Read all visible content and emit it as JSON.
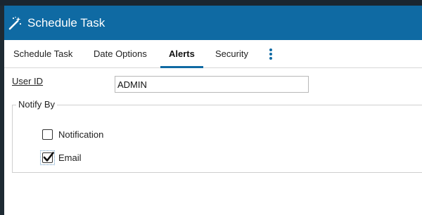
{
  "window": {
    "title": "Schedule Task",
    "icon": "magic-wand-icon"
  },
  "tabs": [
    {
      "label": "Schedule Task",
      "active": false
    },
    {
      "label": "Date Options",
      "active": false
    },
    {
      "label": "Alerts",
      "active": true
    },
    {
      "label": "Security",
      "active": false
    }
  ],
  "more_menu_icon": "kebab-menu-icon",
  "form": {
    "user_id_label": "User ID",
    "user_id_value": "ADMIN",
    "notify_by": {
      "legend": "Notify By",
      "options": [
        {
          "label": "Notification",
          "checked": false
        },
        {
          "label": "Email",
          "checked": true
        }
      ]
    }
  },
  "colors": {
    "accent": "#0f6aa3",
    "titlebar": "#0f6aa3"
  }
}
